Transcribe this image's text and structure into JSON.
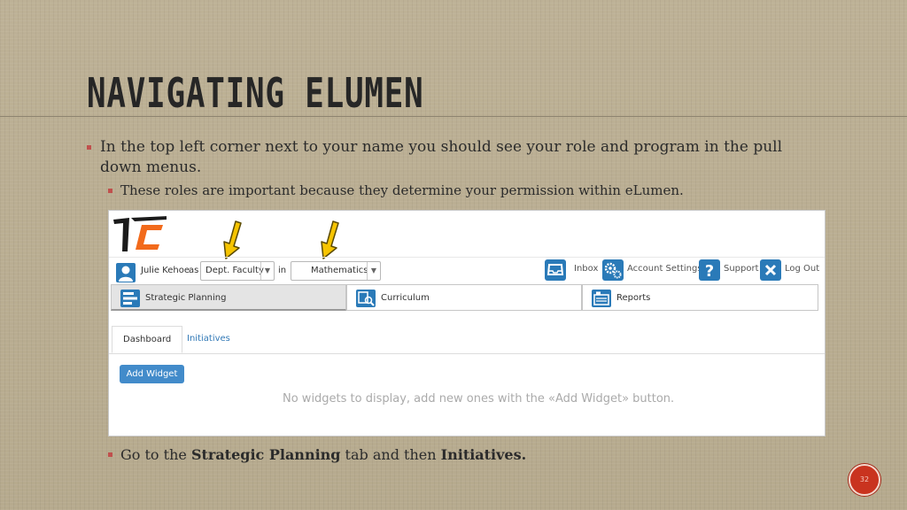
{
  "slide": {
    "title": "Navigating eLumen",
    "bullet1": "In the top left corner next to your name you should see your role and program in the pull down menus.",
    "bullet2": "These roles are important because they determine your permission within eLumen.",
    "bullet3": {
      "pre": "Go to the ",
      "strong1": "Strategic Planning",
      "mid": " tab and then ",
      "strong2": "Initiatives."
    },
    "page_number": "32",
    "accent_color": "#c0504d"
  },
  "app": {
    "user": {
      "name": "Julie Kehoe",
      "as_label": "as",
      "role": "Dept. Faculty",
      "in_label": "in",
      "program": "Mathematics"
    },
    "top_links": [
      {
        "icon": "inbox-icon",
        "label": "Inbox"
      },
      {
        "icon": "settings-icon",
        "label": "Account Settings"
      },
      {
        "icon": "help-icon",
        "label": "Support"
      },
      {
        "icon": "close-icon",
        "label": "Log Out"
      }
    ],
    "modules": [
      {
        "icon": "strategic-planning-icon",
        "label": "Strategic Planning",
        "active": true
      },
      {
        "icon": "curriculum-icon",
        "label": "Curriculum",
        "active": false
      },
      {
        "icon": "reports-icon",
        "label": "Reports",
        "active": false
      }
    ],
    "subtabs": [
      {
        "label": "Dashboard",
        "active": true
      },
      {
        "label": "Initiatives",
        "active": false
      }
    ],
    "add_widget_label": "Add Widget",
    "empty_message": "No widgets to display, add new ones with the «Add Widget» button.",
    "colors": {
      "primary": "#428bca",
      "link": "#337ab7",
      "icon_blue": "#2a7ab8",
      "logo_orange": "#f26a1b",
      "arrow_yellow": "#f6c400"
    }
  }
}
